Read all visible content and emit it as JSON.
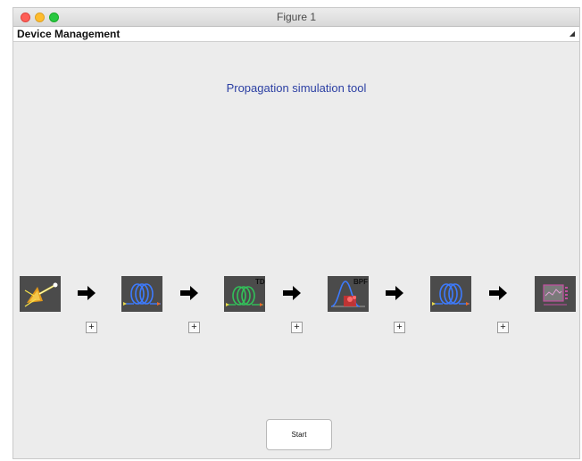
{
  "window": {
    "title": "Figure 1"
  },
  "tab": {
    "label": "Device Management"
  },
  "main": {
    "heading": "Propagation simulation tool"
  },
  "devices": [
    {
      "name": "laser",
      "icon": "laser-source-icon",
      "badge": ""
    },
    {
      "name": "fiber",
      "icon": "fiber-coil-icon",
      "badge": ""
    },
    {
      "name": "td-fiber",
      "icon": "fiber-coil-td-icon",
      "badge": "TD"
    },
    {
      "name": "bpf",
      "icon": "bandpass-filter-icon",
      "badge": "BPF"
    },
    {
      "name": "fiber-2",
      "icon": "fiber-coil-icon",
      "badge": ""
    },
    {
      "name": "scope",
      "icon": "oscilloscope-icon",
      "badge": ""
    }
  ],
  "add_button_label": "+",
  "add_buttons": [
    "+",
    "+",
    "+",
    "+",
    "+"
  ],
  "start_button": {
    "label": "Start"
  },
  "colors": {
    "accent_text": "#2b3fa3",
    "device_bg": "#4b4b4b",
    "coil_blue": "#3d7bff",
    "coil_green": "#32c25a",
    "filter_red": "#d23030"
  }
}
